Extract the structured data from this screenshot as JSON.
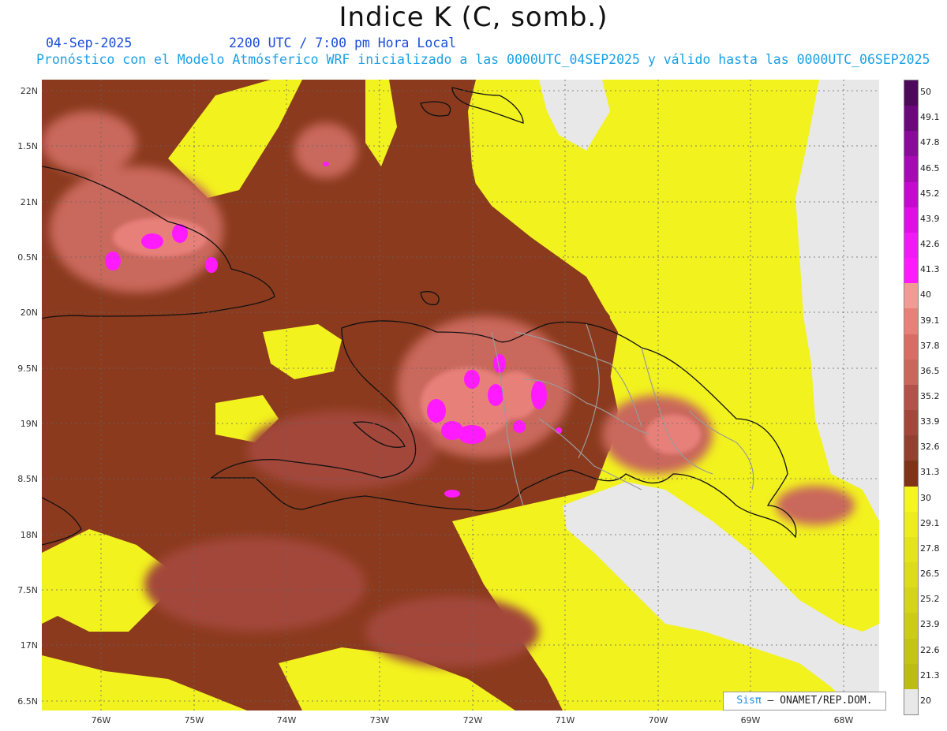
{
  "header": {
    "title": "Indice K (C, somb.)",
    "date": "04-Sep-2025",
    "time": "2200 UTC / 7:00 pm Hora Local",
    "description": "Pronóstico con el Modelo Atmósferico WRF inicializado a las 0000UTC_04SEP2025 y válido hasta las  0000UTC_06SEP2025"
  },
  "map": {
    "y_ticks": [
      "22N",
      "1.5N",
      "21N",
      "0.5N",
      "20N",
      "9.5N",
      "19N",
      "8.5N",
      "18N",
      "7.5N",
      "17N",
      "6.5N"
    ],
    "x_ticks": [
      "76W",
      "75W",
      "74W",
      "73W",
      "72W",
      "71W",
      "70W",
      "69W",
      "68W"
    ],
    "colors": {
      "no_data": "#e8e8e8",
      "yellow": "#f2f21e",
      "yellow_dark": "#d6d61a",
      "brown": "#8b3a1e",
      "brown_mid": "#a3473a",
      "salmon": "#c9675c",
      "pink": "#e8807a",
      "magenta": "#ff1aff",
      "coast": "#111111",
      "borders": "#9a9a9a"
    }
  },
  "colorbar": {
    "labels": [
      "50",
      "49.1",
      "47.8",
      "46.5",
      "45.2",
      "43.9",
      "42.6",
      "41.3",
      "40",
      "39.1",
      "37.8",
      "36.5",
      "35.2",
      "33.9",
      "32.6",
      "31.3",
      "30",
      "29.1",
      "27.8",
      "26.5",
      "25.2",
      "23.9",
      "22.6",
      "21.3",
      "20"
    ],
    "colors": [
      "#4b0a5a",
      "#6a0a7a",
      "#8a0a9a",
      "#a70ab5",
      "#c40ad0",
      "#de10e6",
      "#f01af5",
      "#ff1aff",
      "#f29a94",
      "#e8807a",
      "#d96c64",
      "#c9675c",
      "#b3524a",
      "#a3473a",
      "#934030",
      "#7f3418",
      "#f5f522",
      "#ecec20",
      "#e4e41e",
      "#dcdc1c",
      "#d4d41a",
      "#cccc18",
      "#c4c416",
      "#bcbc14",
      "#e8e8e8"
    ]
  },
  "credit": {
    "brand": "Sisπ",
    "text": " – ONAMET/REP.DOM."
  }
}
